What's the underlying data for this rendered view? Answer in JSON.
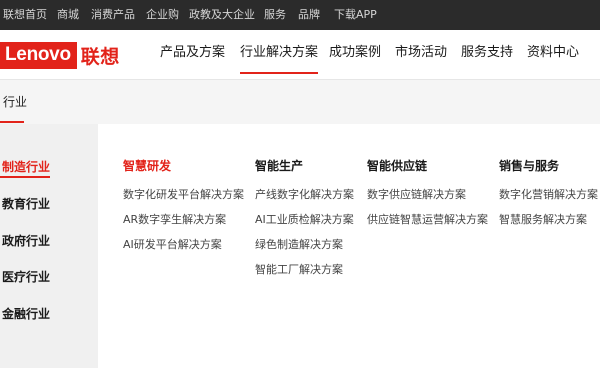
{
  "topbar": {
    "links": [
      "联想首页",
      "商城",
      "消费产品",
      "企业购",
      "政教及大企业",
      "服务",
      "品牌",
      "下载APP"
    ]
  },
  "logo": {
    "en": "Lenovo",
    "zh": "联想"
  },
  "nav": {
    "items": [
      "产品及方案",
      "行业解决方案",
      "成功案例",
      "市场活动",
      "服务支持",
      "资料中心"
    ],
    "active_index": 1
  },
  "category_header": {
    "label": "行业"
  },
  "sidebar": {
    "items": [
      "制造行业",
      "教育行业",
      "政府行业",
      "医疗行业",
      "金融行业"
    ],
    "active_index": 0
  },
  "columns": [
    {
      "title": "智慧研发",
      "links": [
        "数字化研发平台解决方案",
        "AR数字孪生解决方案",
        "AI研发平台解决方案"
      ]
    },
    {
      "title": "智能生产",
      "links": [
        "产线数字化解决方案",
        "AI工业质检解决方案",
        "绿色制造解决方案",
        "智能工厂解决方案"
      ]
    },
    {
      "title": "智能供应链",
      "links": [
        "数字供应链解决方案",
        "供应链智慧运营解决方案"
      ]
    },
    {
      "title": "销售与服务",
      "links": [
        "数字化营销解决方案",
        "智慧服务解决方案"
      ]
    }
  ],
  "colors": {
    "accent": "#e2231a",
    "topbar_bg": "#2b2b2b",
    "sidebar_bg": "#f0f0f0"
  }
}
